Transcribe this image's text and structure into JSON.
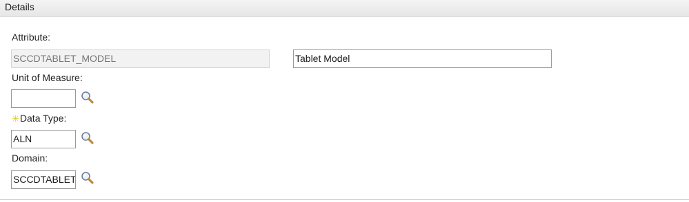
{
  "section": {
    "title": "Details"
  },
  "attribute": {
    "label": "Attribute:",
    "value": "SCCDTABLET_MODEL",
    "description": "Tablet Model"
  },
  "unit_of_measure": {
    "label": "Unit of Measure:",
    "value": "",
    "lookup_icon": "magnifier-icon"
  },
  "data_type": {
    "required_marker": "✳",
    "label": "Data Type:",
    "value": "ALN",
    "lookup_icon": "magnifier-icon"
  },
  "domain": {
    "label": "Domain:",
    "value": "SCCDTABLET",
    "lookup_icon": "magnifier-icon"
  },
  "colors": {
    "header_bg": "#e9e9e9",
    "readonly_bg": "#f2f2f2",
    "required": "#f0c400",
    "field_border": "#9a9a9a"
  }
}
